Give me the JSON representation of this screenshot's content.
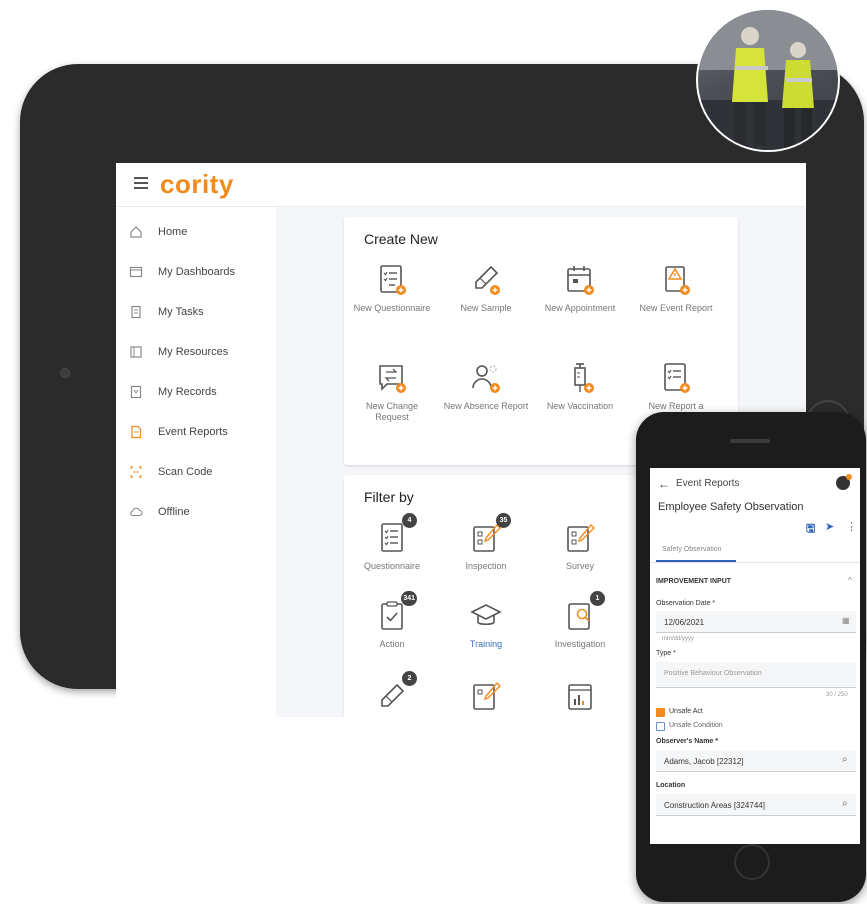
{
  "brand": {
    "logo": "cority",
    "accent": "#f28b1e"
  },
  "sidebar": {
    "items": [
      {
        "label": "Home",
        "icon": "home-icon"
      },
      {
        "label": "My Dashboards",
        "icon": "dashboard-icon"
      },
      {
        "label": "My Tasks",
        "icon": "tasks-icon"
      },
      {
        "label": "My Resources",
        "icon": "resources-icon"
      },
      {
        "label": "My Records",
        "icon": "records-icon"
      },
      {
        "label": "Event Reports",
        "icon": "event-reports-icon"
      },
      {
        "label": "Scan Code",
        "icon": "scan-code-icon"
      },
      {
        "label": "Offline",
        "icon": "cloud-offline-icon"
      }
    ]
  },
  "create_new": {
    "title": "Create New",
    "tiles": [
      {
        "label": "New Questionnaire",
        "icon": "questionnaire-add-icon"
      },
      {
        "label": "New Sample",
        "icon": "sample-add-icon"
      },
      {
        "label": "New Appointment",
        "icon": "appointment-add-icon"
      },
      {
        "label": "New Event Report",
        "icon": "event-report-add-icon"
      },
      {
        "label": "New Change Request",
        "icon": "change-request-add-icon"
      },
      {
        "label": "New Absence Report",
        "icon": "absence-report-add-icon"
      },
      {
        "label": "New Vaccination",
        "icon": "vaccination-add-icon"
      },
      {
        "label": "New Report a Vaccination",
        "icon": "report-vaccination-add-icon"
      }
    ]
  },
  "filter_by": {
    "title": "Filter by",
    "tiles": [
      {
        "label": "Questionnaire",
        "icon": "questionnaire-icon",
        "badge": "4"
      },
      {
        "label": "Inspection",
        "icon": "inspection-icon",
        "badge": "35"
      },
      {
        "label": "Survey",
        "icon": "survey-icon",
        "badge": ""
      },
      {
        "label": "Action",
        "icon": "action-icon",
        "badge": "341"
      },
      {
        "label": "Training",
        "icon": "training-icon",
        "badge": ""
      },
      {
        "label": "Investigation",
        "icon": "investigation-icon",
        "badge": "1"
      },
      {
        "label": "",
        "icon": "sample-icon",
        "badge": "2"
      },
      {
        "label": "",
        "icon": "inspection-icon",
        "badge": ""
      },
      {
        "label": "",
        "icon": "report-icon",
        "badge": ""
      }
    ]
  },
  "phone": {
    "header_title": "Event Reports",
    "form_title": "Employee Safety Observation",
    "tab": "Safety Observation",
    "section": "IMPROVEMENT INPUT",
    "observation_date_label": "Observation Date *",
    "observation_date_value": "12/06/2021",
    "date_format_hint": "mm/dd/yyyy",
    "type_label": "Type *",
    "type_value": "Positive Behaviour Observation",
    "char_count": "30 / 250",
    "checkbox_unsafe_act": "Unsafe Act",
    "checkbox_unsafe_condition": "Unsafe Condition",
    "observer_label": "Observer's Name *",
    "observer_value": "Adams, Jacob [22312]",
    "location_label": "Location",
    "location_value": "Construction Areas [324744]"
  }
}
